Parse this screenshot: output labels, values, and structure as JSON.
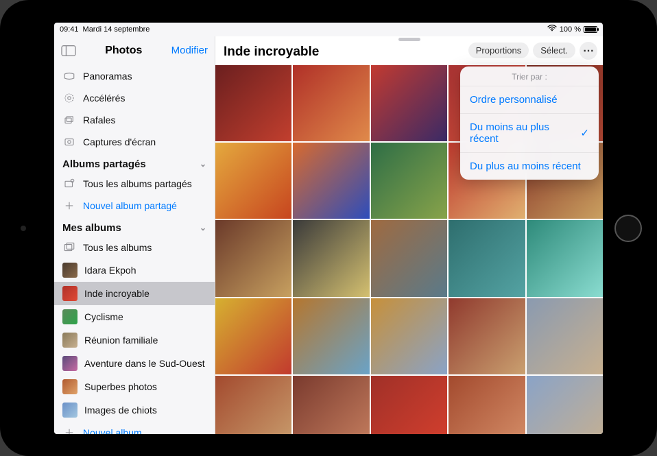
{
  "status": {
    "time": "09:41",
    "date": "Mardi 14 septembre",
    "battery_pct": "100 %"
  },
  "sidebar": {
    "title": "Photos",
    "action": "Modifier",
    "media_types": {
      "panoramas": "Panoramas",
      "acceleres": "Accélérés",
      "rafales": "Rafales",
      "captures": "Captures d'écran"
    },
    "shared_section": "Albums partagés",
    "shared_all": "Tous les albums partagés",
    "shared_new": "Nouvel album partagé",
    "my_section": "Mes albums",
    "albums": {
      "all": "Tous les albums",
      "a0": "Idara Ekpoh",
      "a1": "Inde incroyable",
      "a2": "Cyclisme",
      "a3": "Réunion familiale",
      "a4": "Aventure dans le Sud-Ouest",
      "a5": "Superbes photos",
      "a6": "Images de chiots"
    },
    "new_album": "Nouvel album"
  },
  "main": {
    "title": "Inde incroyable",
    "toolbar": {
      "aspect": "Proportions",
      "select": "Sélect.",
      "more": "⋯"
    }
  },
  "popover": {
    "title": "Trier par :",
    "opt_custom": "Ordre personnalisé",
    "opt_oldest_first": "Du moins au plus récent",
    "opt_newest_first": "Du plus au moins récent",
    "selected": "opt_oldest_first"
  }
}
